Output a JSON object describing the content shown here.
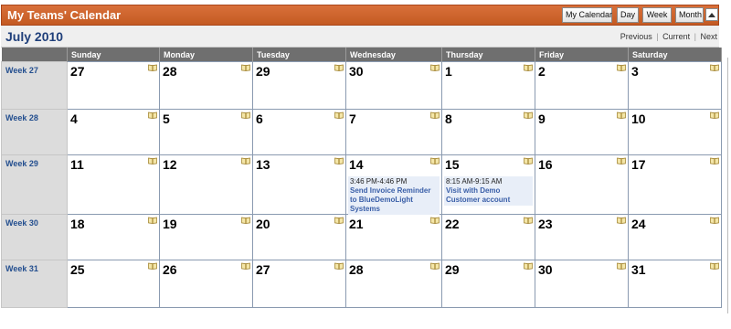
{
  "header": {
    "title": "My Teams' Calendar",
    "buttons": {
      "my_calendar": "My Calendar",
      "day": "Day",
      "week": "Week",
      "month": "Month"
    },
    "collapse_icon": "chevron-up-icon"
  },
  "subbar": {
    "month": "July 2010",
    "nav": {
      "previous": "Previous",
      "current": "Current",
      "next": "Next",
      "sep": "|"
    }
  },
  "columns": [
    "Sunday",
    "Monday",
    "Tuesday",
    "Wednesday",
    "Thursday",
    "Friday",
    "Saturday"
  ],
  "weeks": [
    {
      "label": "Week 27",
      "days": [
        "27",
        "28",
        "29",
        "30",
        "1",
        "2",
        "3"
      ]
    },
    {
      "label": "Week 28",
      "days": [
        "4",
        "5",
        "6",
        "7",
        "8",
        "9",
        "10"
      ]
    },
    {
      "label": "Week 29",
      "days": [
        "11",
        "12",
        "13",
        "14",
        "15",
        "16",
        "17"
      ]
    },
    {
      "label": "Week 30",
      "days": [
        "18",
        "19",
        "20",
        "21",
        "22",
        "23",
        "24"
      ]
    },
    {
      "label": "Week 31",
      "days": [
        "25",
        "26",
        "27",
        "28",
        "29",
        "30",
        "31"
      ]
    }
  ],
  "events": [
    {
      "week": 2,
      "day": 3,
      "time": "3:46 PM-4:46 PM",
      "title": "Send Invoice Reminder to BlueDemoLight Systems"
    },
    {
      "week": 2,
      "day": 4,
      "time": "8:15 AM-9:15 AM",
      "title": "Visit with Demo Customer account"
    }
  ],
  "colors": {
    "title_bar": "#c45a22",
    "header_bg": "#6f6f6f",
    "week_bg": "#dcdcdc",
    "link": "#244f8f",
    "event_bg": "#e8eef8"
  }
}
